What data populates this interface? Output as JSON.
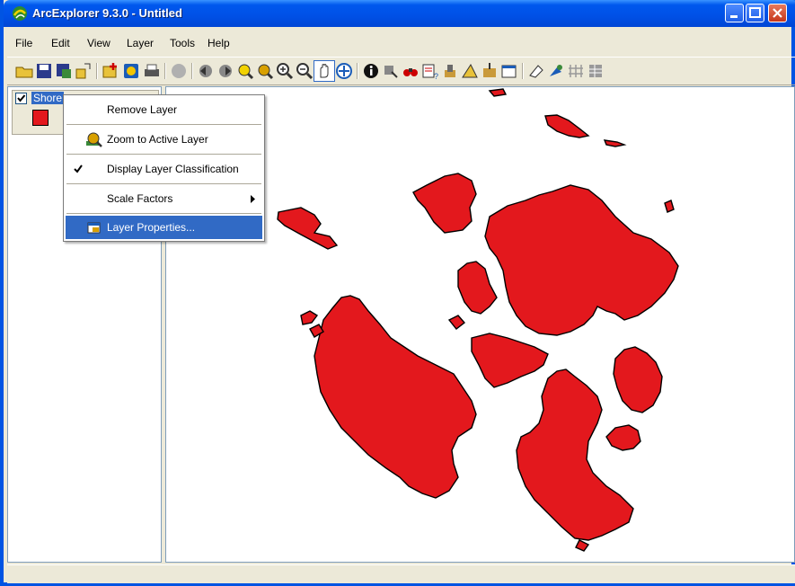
{
  "window": {
    "title": "ArcExplorer 9.3.0 - Untitled"
  },
  "menu": [
    "File",
    "Edit",
    "View",
    "Layer",
    "Tools",
    "Help"
  ],
  "toc": {
    "layer_name": "Shore",
    "checked": true,
    "symbol_color": "#e3181d"
  },
  "context_menu": {
    "items": [
      {
        "label": "Remove Layer",
        "icon": "none"
      },
      {
        "label": "Zoom to Active Layer",
        "icon": "zoom-layer-icon"
      },
      {
        "label": "Display Layer Classification",
        "icon": "checkmark-icon",
        "checked": true
      },
      {
        "label": "Scale Factors",
        "icon": "none",
        "submenu": true
      },
      {
        "label": "Layer Properties...",
        "icon": "properties-icon",
        "selected": true
      }
    ]
  },
  "map": {
    "fill_color": "#e3181d",
    "stroke_color": "#000000"
  },
  "colors": {
    "titlebar": "#0054e3",
    "selection": "#316ac5",
    "chrome": "#ece9d8"
  }
}
